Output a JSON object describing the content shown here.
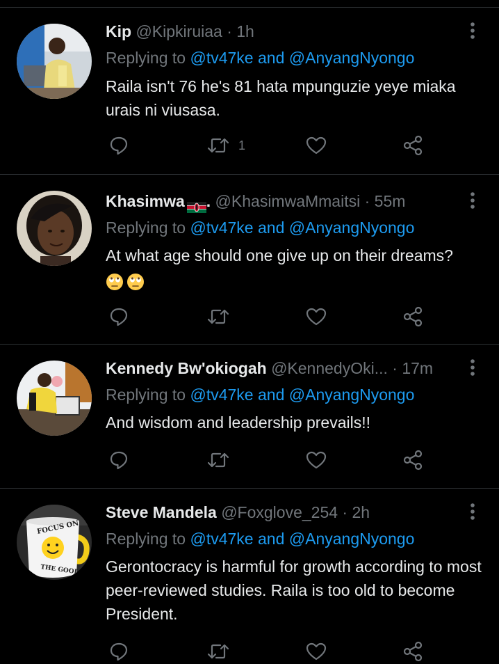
{
  "tweets": [
    {
      "name": "Kip",
      "handle": "@Kipkiruiaa",
      "time": "1h",
      "replying_prefix": "Replying to",
      "mention1": "@tv47ke",
      "and": "and",
      "mention2": "@AnyangNyongo",
      "text": "Raila isn't 76 he's 81 hata mpunguzie yeye miaka urais ni viusasa.",
      "retweet_count": "1"
    },
    {
      "name": "Khasimwa",
      "name_suffix": ".",
      "handle": "@KhasimwaMmaitsi",
      "time": "55m",
      "replying_prefix": "Replying to",
      "mention1": "@tv47ke",
      "and": "and",
      "mention2": "@AnyangNyongo",
      "text": "At what age should one give up on their dreams?",
      "retweet_count": ""
    },
    {
      "name": "Kennedy Bw'okiogah",
      "handle": "@KennedyOki...",
      "time": "17m",
      "replying_prefix": "Replying to",
      "mention1": "@tv47ke",
      "and": "and",
      "mention2": "@AnyangNyongo",
      "text": "And wisdom and leadership prevails!!",
      "retweet_count": ""
    },
    {
      "name": "Steve Mandela",
      "handle": "@Foxglove_254",
      "time": "2h",
      "replying_prefix": "Replying to",
      "mention1": "@tv47ke",
      "and": "and",
      "mention2": "@AnyangNyongo",
      "text": "Gerontocracy is harmful for growth according to most peer-reviewed studies. Raila is too old to become President.",
      "retweet_count": ""
    }
  ],
  "separator": "·",
  "icons": {
    "reply": "reply-icon",
    "retweet": "retweet-icon",
    "like": "heart-icon",
    "share": "share-icon",
    "more": "more-options-icon",
    "emoji": "face-with-rolling-eyes-emoji",
    "flag": "kenya-flag-emoji"
  },
  "avatar_logo_text": {
    "mug_top": "FOCUS ON",
    "mug_bottom": "THE GOOD"
  },
  "colors": {
    "background": "#000000",
    "text_primary": "#e7e9ea",
    "text_secondary": "#71767b",
    "link": "#1d9bf0",
    "divider": "#2f3336"
  }
}
